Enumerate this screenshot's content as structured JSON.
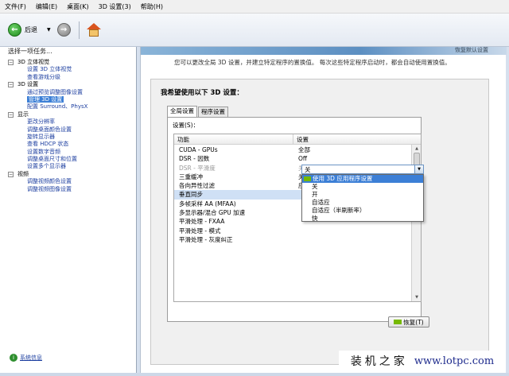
{
  "menu": [
    "文件(F)",
    "编辑(E)",
    "桌面(K)",
    "3D 设置(3)",
    "帮助(H)"
  ],
  "toolbar": {
    "back_label": "后退"
  },
  "left_panel": {
    "title": "选择一项任务...",
    "tree": [
      {
        "label": "3D 立体视觉",
        "level": 0
      },
      {
        "label": "设置 3D 立体视觉",
        "level": 1
      },
      {
        "label": "查看游戏分级",
        "level": 1
      },
      {
        "label": "3D 设置",
        "level": 0
      },
      {
        "label": "通过预览调整图像设置",
        "level": 1
      },
      {
        "label": "管理 3D 设置",
        "level": 1,
        "selected": true
      },
      {
        "label": "配置 Surround、PhysX",
        "level": 1
      },
      {
        "label": "显示",
        "level": 0
      },
      {
        "label": "更改分辨率",
        "level": 1
      },
      {
        "label": "调整桌面颜色设置",
        "level": 1
      },
      {
        "label": "旋转显示器",
        "level": 1
      },
      {
        "label": "查看 HDCP 状态",
        "level": 1
      },
      {
        "label": "设置数字音频",
        "level": 1
      },
      {
        "label": "调整桌面尺寸和位置",
        "level": 1
      },
      {
        "label": "设置多个显示器",
        "level": 1
      },
      {
        "label": "视频",
        "level": 0
      },
      {
        "label": "调整视频颜色设置",
        "level": 1
      },
      {
        "label": "调整视频图像设置",
        "level": 1
      }
    ],
    "system_info": "系统信息"
  },
  "main": {
    "banner_right": "恢复默认设置",
    "intro": "您可以更改全局 3D 设置，并建立特定程序的置换值。 每次这些特定程序启动时，都会自动使用置换值。",
    "heading": "我希望使用以下 3D 设置：",
    "tabs": [
      "全局设置",
      "程序设置"
    ],
    "settings_label": "设置(S)：",
    "columns": {
      "feature": "功能",
      "setting": "设置"
    },
    "rows": [
      {
        "feature": "CUDA - GPUs",
        "value": "全部"
      },
      {
        "feature": "DSR - 因数",
        "value": "Off"
      },
      {
        "feature": "DSR - 平滑度",
        "value": "关",
        "dim": true
      },
      {
        "feature": "三重缓冲",
        "value": "关"
      },
      {
        "feature": "各向异性过滤",
        "value": "应用程序控制的"
      },
      {
        "feature": "垂直同步",
        "value": "",
        "selected": true
      },
      {
        "feature": "多帧采样 AA (MFAA)",
        "value": ""
      },
      {
        "feature": "多显示器/混合 GPU 加速",
        "value": ""
      },
      {
        "feature": "平滑处理 - FXAA",
        "value": ""
      },
      {
        "feature": "平滑处理 - 模式",
        "value": ""
      },
      {
        "feature": "平滑处理 - 灰度纠正",
        "value": ""
      }
    ],
    "combo_value": "关",
    "dropdown_options": [
      "使用 3D 应用程序设置",
      "关",
      "开",
      "自适应",
      "自适应（半刷新率）",
      "快"
    ],
    "restore_label": "恢复(T)"
  },
  "watermark": {
    "cn": "装机之家",
    "url": "www.lotpc.com"
  },
  "colors": {
    "accent": "#3c7fd6",
    "nvidia_green": "#76b900"
  }
}
